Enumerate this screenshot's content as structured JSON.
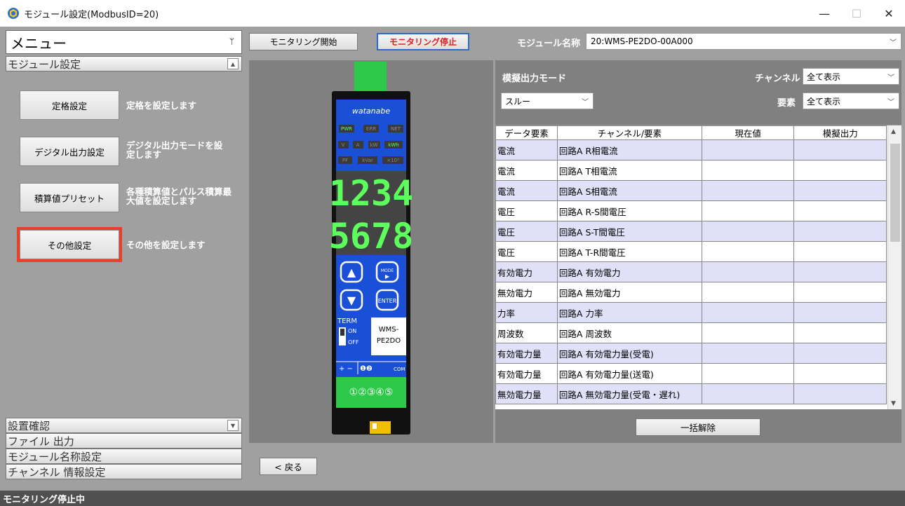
{
  "window": {
    "title": "モジュール設定(ModbusID=20)",
    "minimize": "—",
    "maximize": "☐",
    "close": "✕"
  },
  "sidebar": {
    "menu_title": "メニュー",
    "pin": "ᛘ",
    "sections": [
      {
        "label": "モジュール設定"
      },
      {
        "label": "設置確認"
      },
      {
        "label": "ファイル 出力"
      },
      {
        "label": "モジュール名称設定"
      },
      {
        "label": "チャンネル 情報設定"
      }
    ],
    "module_items": [
      {
        "button": "定格設定",
        "desc": "定格を設定します"
      },
      {
        "button": "デジタル出力設定",
        "desc": "デジタル出力モードを設定します"
      },
      {
        "button": "積算値プリセット",
        "desc": "各種積算値とパルス積算最大値を設定します"
      },
      {
        "button": "その他設定",
        "desc": "その他を設定します"
      }
    ]
  },
  "toolbar": {
    "start_label": "モニタリング開始",
    "stop_label": "モニタリング停止",
    "module_name_label": "モジュール名称",
    "module_name_value": "20:WMS-PE2DO-00A000"
  },
  "device": {
    "brand": "watanabe",
    "leds_row1": [
      "PWR",
      "ERR",
      "NET"
    ],
    "leds_row2": [
      "V",
      "A",
      "kW",
      "kWh"
    ],
    "leds_row3": [
      "PF",
      "kVar",
      "×10³"
    ],
    "digits_top": "1234",
    "digits_bottom": "5678",
    "btn_up": "▲",
    "btn_mode": "MODE",
    "btn_down": "▼",
    "btn_enter": "ENTER",
    "term": "TERM",
    "on": "ON",
    "off": "OFF",
    "model_line1": "WMS-",
    "model_line2": "PE2DO",
    "terminal_labels": "+ −",
    "terminal_nums": "❶❷",
    "com": "COM",
    "connector": "①②③④⑤"
  },
  "right": {
    "sim_mode_label": "模擬出力モード",
    "sim_mode_value": "スルー",
    "channel_label": "チャンネル",
    "channel_value": "全て表示",
    "element_label": "要素",
    "element_value": "全て表示",
    "columns": [
      "データ要素",
      "チャンネル/要素",
      "現在値",
      "模擬出力"
    ],
    "rows": [
      {
        "type": "電流",
        "channel": "回路A R相電流",
        "current": "",
        "sim": ""
      },
      {
        "type": "電流",
        "channel": "回路A T相電流",
        "current": "",
        "sim": ""
      },
      {
        "type": "電流",
        "channel": "回路A S相電流",
        "current": "",
        "sim": ""
      },
      {
        "type": "電圧",
        "channel": "回路A R-S間電圧",
        "current": "",
        "sim": ""
      },
      {
        "type": "電圧",
        "channel": "回路A S-T間電圧",
        "current": "",
        "sim": ""
      },
      {
        "type": "電圧",
        "channel": "回路A T-R間電圧",
        "current": "",
        "sim": ""
      },
      {
        "type": "有効電力",
        "channel": "回路A 有効電力",
        "current": "",
        "sim": ""
      },
      {
        "type": "無効電力",
        "channel": "回路A 無効電力",
        "current": "",
        "sim": ""
      },
      {
        "type": "力率",
        "channel": "回路A 力率",
        "current": "",
        "sim": ""
      },
      {
        "type": "周波数",
        "channel": "回路A 周波数",
        "current": "",
        "sim": ""
      },
      {
        "type": "有効電力量",
        "channel": "回路A 有効電力量(受電)",
        "current": "",
        "sim": ""
      },
      {
        "type": "有効電力量",
        "channel": "回路A 有効電力量(送電)",
        "current": "",
        "sim": ""
      },
      {
        "type": "無効電力量",
        "channel": "回路A 無効電力量(受電・遅れ)",
        "current": "",
        "sim": ""
      }
    ],
    "release_all": "一括解除"
  },
  "back_label": "< 戻る",
  "status": "モニタリング停止中",
  "colors": {
    "accent_red": "#e8402a",
    "stop_red": "#e02020",
    "device_blue": "#1a4fd8",
    "connector_green": "#2fc94a",
    "led_green": "#5cff5c"
  }
}
